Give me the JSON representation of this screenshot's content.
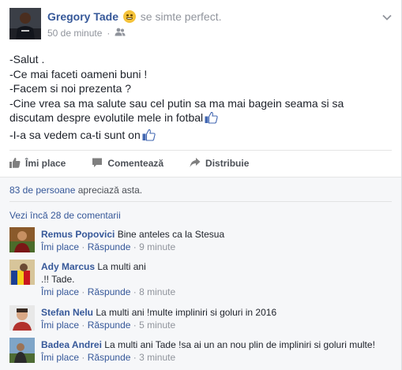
{
  "post": {
    "author": "Gregory Tade",
    "feeling": "se simte perfect.",
    "time": "50 de minute",
    "lines": [
      "-Salut .",
      "-Ce mai faceti oameni buni !",
      "-Facem si noi prezenta ?",
      "-Cine vrea sa ma salute sau cel putin sa ma mai bagein seama si sa discutam despre evolutile mele in fotbal",
      "-I-a sa vedem ca-ti sunt on"
    ]
  },
  "actions": {
    "like": "Îmi place",
    "comment": "Comentează",
    "share": "Distribuie"
  },
  "likes": {
    "count": "83 de persoane",
    "suffix": " apreciază asta."
  },
  "more_comments": "Vezi încă 28 de comentarii",
  "comments": [
    {
      "name": "Remus Popovici",
      "text": "Bine anteles ca la Stesua",
      "like": "Îmi place",
      "reply": "Răspunde",
      "time": "9 minute"
    },
    {
      "name": "Ady Marcus",
      "text": "La multi ani",
      "text2": ".!! Tade.",
      "like": "Îmi place",
      "reply": "Răspunde",
      "time": "8 minute"
    },
    {
      "name": "Stefan Nelu",
      "text": "La multi ani !multe impliniri si goluri in 2016",
      "like": "Îmi place",
      "reply": "Răspunde",
      "time": "5 minute"
    },
    {
      "name": "Badea Andrei",
      "text": "La multi ani Tade !sa ai un an nou plin de impliniri si goluri multe!",
      "like": "Îmi place",
      "reply": "Răspunde",
      "time": "3 minute"
    }
  ],
  "icons": {
    "audience": "friends-icon",
    "menu": "chevron-down-icon",
    "like": "thumbs-up-icon",
    "comment": "speech-bubble-icon",
    "share": "share-arrow-icon"
  },
  "colors": {
    "link": "#365899",
    "muted": "#90949c",
    "text": "#1d2129"
  }
}
